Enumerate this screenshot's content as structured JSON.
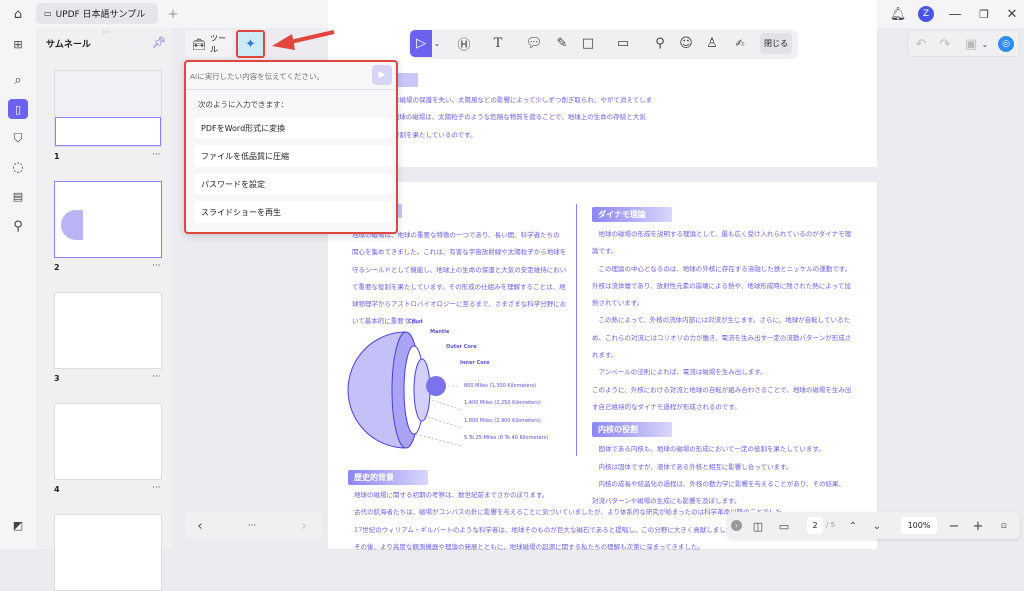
{
  "app": {
    "tab_title": "UPDF 日本語サンプル",
    "avatar_letter": "Z",
    "accent": "#6b63f0",
    "highlight": "#e0463d"
  },
  "sidebar": {
    "title": "サムネール",
    "pages": [
      {
        "num": "1"
      },
      {
        "num": "2"
      },
      {
        "num": "3"
      },
      {
        "num": "4"
      }
    ]
  },
  "tools": {
    "tools_label": "ツール"
  },
  "ai": {
    "placeholder": "AIに実行したい内容を伝えてください。",
    "hint": "次のように入力できます：",
    "suggestions": [
      "PDFをWord形式に変換",
      "ファイルを低品質に圧縮",
      "パスワードを設定",
      "スライドショーを再生"
    ]
  },
  "annot": {
    "close_label": "閉じる"
  },
  "page1": {
    "lines": [
      "大気は磁場の保護を失い、太陽風などの影響によって少しずつ削ぎ取られ、やがて消えてしま",
      "り、地球の磁場は、太陽粒子のような危険な物質を遮ることで、地球上の生命の存続と大気",
      "欠な役割を果たしているのです。"
    ]
  },
  "page2": {
    "left_lines": [
      "地球の磁場は、地球の重要な特徴の一つであり、長い間、科学者たちの",
      "関心を集めてきました。これは、有害な宇宙放射線や太陽粒子から地球を",
      "守るシールドとして機能し、地球上の生命の保護と大気の安定維持におい",
      "て重要な役割を果たしています。その形成の仕組みを理解することは、地",
      "球物理学からアストロバイオロジーに至るまで、さまざまな科学分野にお",
      "いて基本的に重要です。"
    ],
    "diagram": {
      "crust": "Crust",
      "mantle": "Mantle",
      "outer_core": "Outer Core",
      "inner_core": "Inner Core",
      "d1": "800 Miles (1,300 Kilometers)",
      "d2": "1,400 Miles (2,250 Kilometers)",
      "d3": "1,800 Miles (2,900 Kilometers)",
      "d4": "5 To 25 Miles (8 To 40 Kilometers)"
    },
    "dynamo_heading": "ダイナモ理論",
    "dynamo_lines": [
      "　地球の磁場の形成を説明する理論として、最も広く受け入れられているのがダイナモ理",
      "論です。",
      "　この理論の中心となるのは、地球の外核に存在する溶融した鉄とニッケルの運動です。",
      "外核は流体層であり、放射性元素の崩壊による熱や、地球形成時に残された熱によって加",
      "熱されています。",
      "　この熱によって、外核の流体内部には対流が生じます。さらに、地球が自転しているた",
      "め、これらの対流にはコリオリの力が働き、電流を生み出す一定の流動パターンが形成さ",
      "れます。",
      "　アンペールの法則によれば、電流は磁場を生み出します。",
      "このように、外核における対流と地球の自転が組み合わさることで、地球の磁場を生み出",
      "す自己維持的なダイナモ過程が形成されるのです。"
    ],
    "core_heading": "内核の役割",
    "core_lines": [
      "　固体である内核も、地球の磁場の形成において一定の役割を果たしています。",
      "　内核は固体ですが、液体である外核と相互に影響し合っています。",
      "　内核の成長や結晶化の過程は、外核の動力学に影響を与えることがあり、その結果、",
      "対流パターンや磁場の生成にも影響を及ぼします。"
    ],
    "history_heading": "歴史的背景",
    "history_lines": [
      "地球の磁場に関する初期の考察は、数世紀前までさかのぼります。",
      "古代の航海者たちは、磁場がコンパスの針に影響を与えることに気づいていましたが、より体系的な研究が始まったのは科学革命以降のことでした。",
      "17世紀のウィリアム・ギルバートのような科学者は、地球そのものが巨大な磁石であると提唱し、この分野に大きく貢献しました。",
      "その後、より高度な観測機器や理論の発展とともに、地球磁場の起源に関する私たちの理解も次第に深まってきました。"
    ]
  },
  "bottom": {
    "current_page": "2",
    "total_pages": "/ 5",
    "zoom": "100%"
  }
}
